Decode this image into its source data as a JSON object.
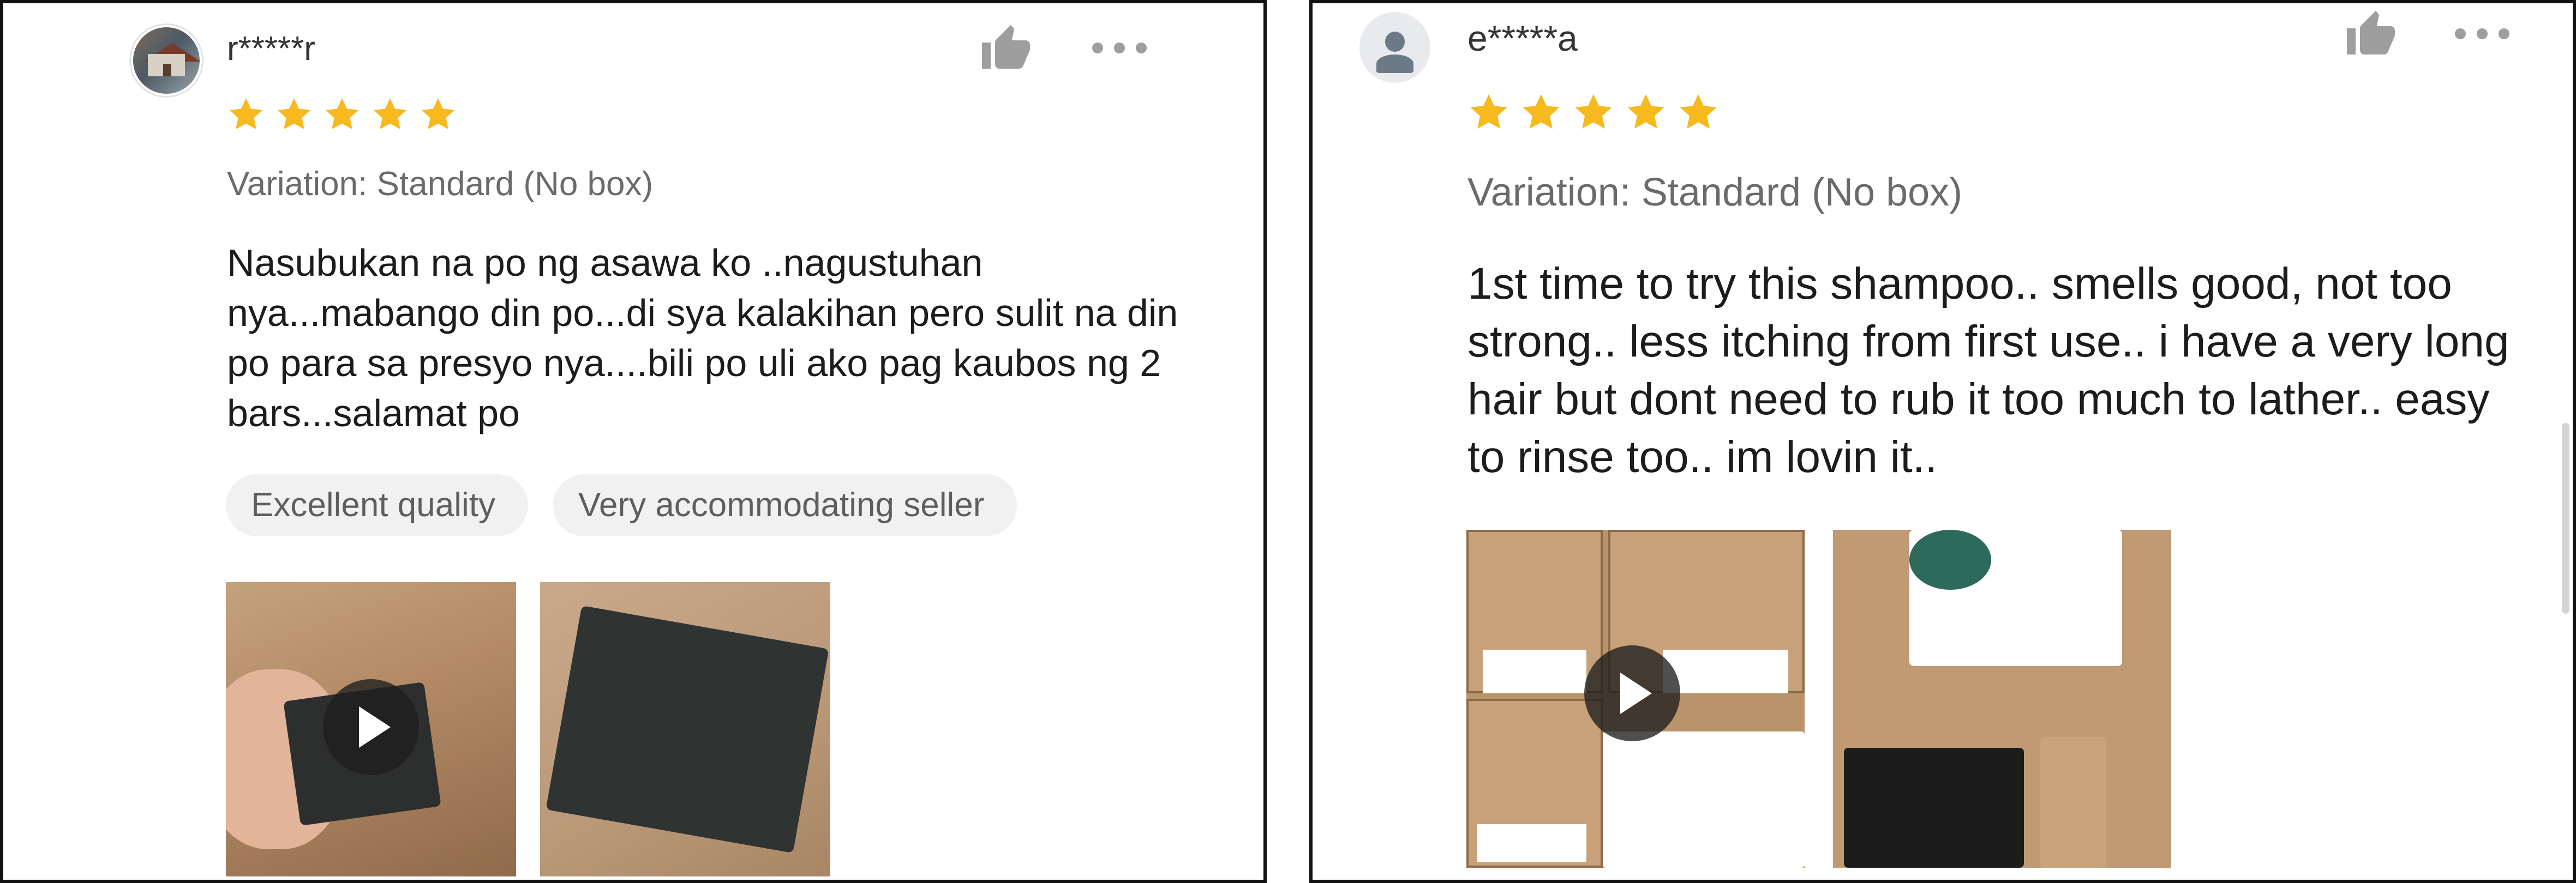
{
  "reviews": [
    {
      "username": "r*****r",
      "rating": 5,
      "variation": "Variation: Standard (No box)",
      "text": "Nasubukan na po ng asawa ko ..nagustuhan nya...mabango din po...di sya kalakihan pero sulit na din po para sa presyo nya....bili po uli ako pag kaubos ng 2 bars...salamat po",
      "tags": [
        "Excellent quality",
        "Very accommodating seller"
      ],
      "media": [
        "video",
        "photo"
      ]
    },
    {
      "username": "e*****a",
      "rating": 5,
      "variation": "Variation: Standard (No box)",
      "text": "1st time to try this shampoo.. smells good, not too strong..  less itching from first use.. i have a very long hair but dont need to rub it too much to lather.. easy to rinse too.. im lovin it..",
      "tags": [],
      "media": [
        "video",
        "photo"
      ]
    }
  ],
  "icons": {
    "like": "thumbs-up-icon",
    "more": "more-options-icon",
    "play": "play-icon",
    "star": "star-icon"
  },
  "colors": {
    "star": "#F7BA1E",
    "icon": "#9E9E9E",
    "tag_bg": "#F1F1F1"
  }
}
